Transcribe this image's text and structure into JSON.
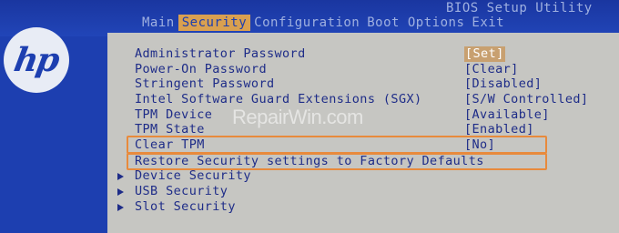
{
  "bios": {
    "title": "BIOS Setup Utility",
    "menu": [
      "Main",
      "Security",
      "Configuration",
      "Boot Options",
      "Exit"
    ],
    "active_menu": "Security"
  },
  "logo": "hp",
  "watermark": "RepairWin.com",
  "settings": [
    {
      "label": "Administrator Password",
      "value": "[Set]"
    },
    {
      "label": "Power-On Password",
      "value": "[Clear]"
    },
    {
      "label": "Stringent Password",
      "value": "[Disabled]"
    },
    {
      "label": "Intel Software Guard Extensions (SGX)",
      "value": "[S/W Controlled]"
    },
    {
      "label": "TPM Device",
      "value": "[Available]"
    },
    {
      "label": "TPM State",
      "value": "[Enabled]"
    },
    {
      "label": "Clear TPM",
      "value": "[No]"
    }
  ],
  "action": "Restore Security settings to Factory Defaults",
  "submenus": [
    "Device Security",
    "USB Security",
    "Slot Security"
  ],
  "colors": {
    "background": "#1d3fb0",
    "panel": "#c6c6c2",
    "text": "#1e2c88",
    "highlight": "#d9a050",
    "annotation_box": "#e88a3c"
  }
}
